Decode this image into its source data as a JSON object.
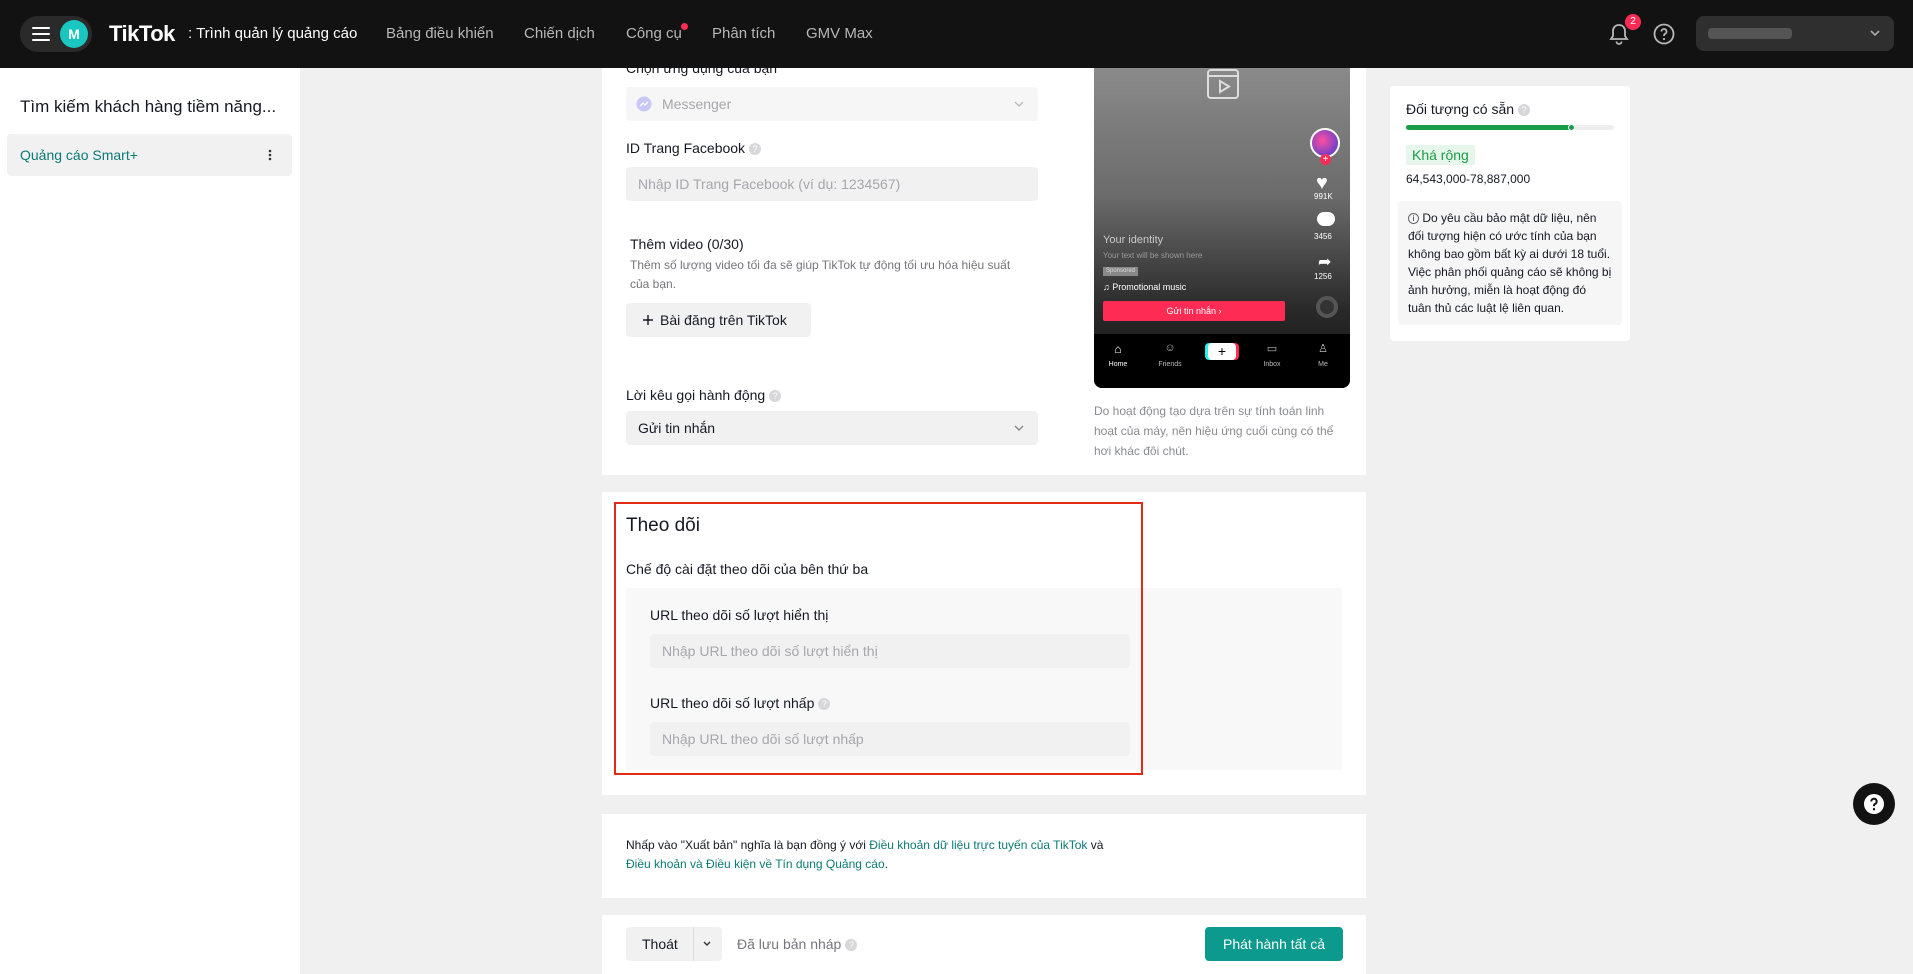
{
  "topbar": {
    "avatar_letter": "M",
    "brand": "TikTok",
    "brand_sub": ": Trình quản lý quảng cáo",
    "nav": [
      "Bảng điều khiển",
      "Chiến dịch",
      "Công cụ",
      "Phân tích",
      "GMV Max"
    ],
    "notification_count": "2"
  },
  "sidebar": {
    "title": "Tìm kiếm khách hàng tiềm năng...",
    "items": [
      {
        "label": "Quảng cáo Smart+"
      }
    ]
  },
  "form": {
    "app_select_label_partial": "Chọn ứng dụng của bạn",
    "app_select_value": "Messenger",
    "facebook_id_label": "ID Trang Facebook",
    "facebook_id_placeholder": "Nhập ID Trang Facebook (ví dụ: 1234567)",
    "add_video_title": "Thêm video (0/30)",
    "add_video_desc": "Thêm số lượng video tối đa sẽ giúp TikTok tự động tối ưu hóa hiệu suất của bạn.",
    "add_post_button": "Bài đăng trên TikTok",
    "cta_label": "Lời kêu gọi hành động",
    "cta_value": "Gửi tin nhắn"
  },
  "preview": {
    "identity": "Your identity",
    "text_hint": "Your text will be shown here",
    "sponsored": "Sponsored",
    "music": "Promotional music",
    "cta_button": "Gửi tin nhắn",
    "likes": "991K",
    "comments": "3456",
    "shares": "1256",
    "tabs": [
      "Home",
      "Friends",
      "",
      "Inbox",
      "Me"
    ],
    "note": "Do hoạt động tạo dựa trên sự tính toán linh hoạt của máy, nên hiệu ứng cuối cùng có thể hơi khác đôi chút."
  },
  "audience": {
    "title": "Đối tượng có sẵn",
    "level": "Khá rộng",
    "range": "64,543,000-78,887,000",
    "note": "Do yêu cầu bảo mật dữ liệu, nên đối tượng hiện có ước tính của bạn không bao gồm bất kỳ ai dưới 18 tuổi. Việc phân phối quảng cáo sẽ không bị ảnh hưởng, miễn là hoạt động đó tuân thủ các luật lệ liên quan.",
    "gauge_fraction": 0.8
  },
  "tracking": {
    "title": "Theo dõi",
    "mode_label": "Chế độ cài đặt theo dõi của bên thứ ba",
    "impression_label": "URL theo dõi số lượt hiển thị",
    "impression_placeholder": "Nhập URL theo dõi số lượt hiển thị",
    "click_label": "URL theo dõi số lượt nhấp",
    "click_placeholder": "Nhập URL theo dõi số lượt nhấp"
  },
  "terms": {
    "prefix": "Nhấp vào \"Xuất bản\" nghĩa là bạn đồng ý với ",
    "link1": "Điều khoản dữ liệu trực tuyến của TikTok",
    "middle": " và",
    "link2": "Điều khoản và Điều kiện về Tín dụng Quảng cáo",
    "suffix": "."
  },
  "footer": {
    "exit_label": "Thoát",
    "draft_status": "Đã lưu bản nháp",
    "publish_label": "Phát hành tất cả"
  },
  "colors": {
    "accent": "#0b9a8d",
    "link": "#0b7a75",
    "highlight": "#e32a19"
  }
}
